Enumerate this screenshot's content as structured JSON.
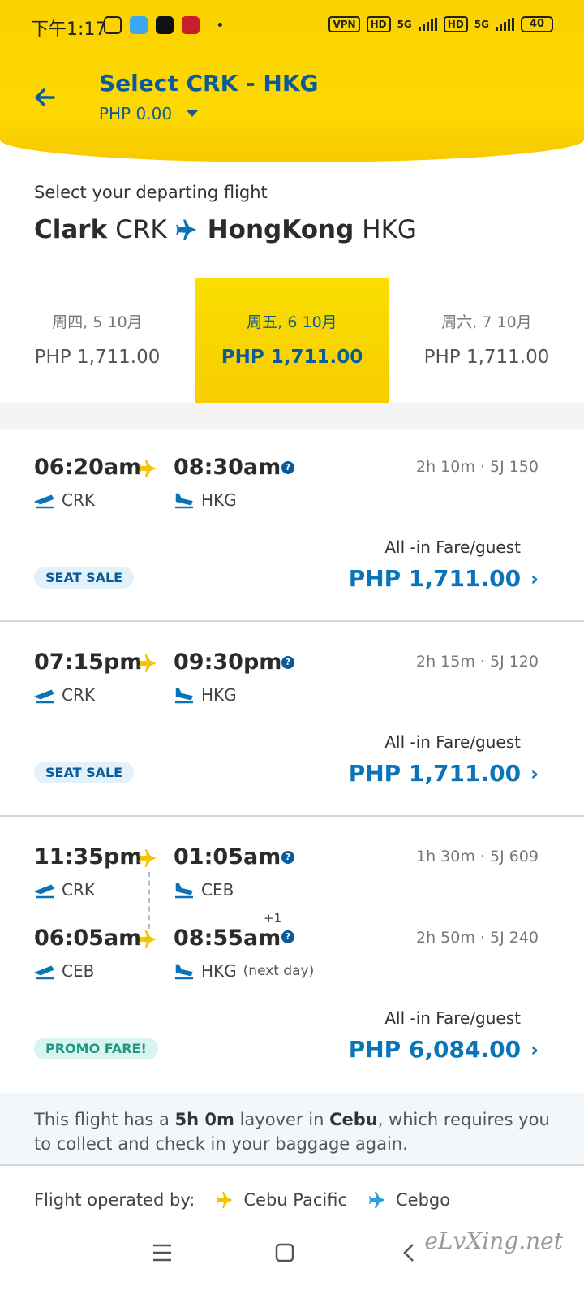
{
  "status_bar": {
    "time": "下午1:17",
    "vpn": "VPN",
    "hd": "HD",
    "net": "5G",
    "battery": "40"
  },
  "header": {
    "title": "Select CRK - HKG",
    "total": "PHP 0.00"
  },
  "route": {
    "label": "Select your departing flight",
    "origin_city": "Clark",
    "origin_code": "CRK",
    "dest_city": "HongKong",
    "dest_code": "HKG"
  },
  "dates": [
    {
      "day": "周四, 5 10月",
      "price": "PHP 1,711.00"
    },
    {
      "day": "周五, 6 10月",
      "price": "PHP 1,711.00",
      "selected": true
    },
    {
      "day": "周六, 7 10月",
      "price": "PHP 1,711.00"
    }
  ],
  "flights": [
    {
      "depart": "06:20am",
      "arrive": "08:30am",
      "from": "CRK",
      "to": "HKG",
      "duration": "2h 10m · 5J 150",
      "fare_label": "All -in Fare/guest",
      "fare": "PHP 1,711.00",
      "badge": "SEAT SALE"
    },
    {
      "depart": "07:15pm",
      "arrive": "09:30pm",
      "from": "CRK",
      "to": "HKG",
      "duration": "2h 15m · 5J 120",
      "fare_label": "All -in Fare/guest",
      "fare": "PHP 1,711.00",
      "badge": "SEAT SALE"
    },
    {
      "leg1": {
        "depart": "11:35pm",
        "arrive": "01:05am",
        "from": "CRK",
        "to": "CEB",
        "duration": "1h 30m · 5J 609"
      },
      "leg2": {
        "depart": "06:05am",
        "arrive": "08:55am",
        "plus": "+1",
        "from": "CEB",
        "to": "HKG",
        "next_day": "(next day)",
        "duration": "2h 50m · 5J 240"
      },
      "fare_label": "All -in Fare/guest",
      "fare": "PHP 6,084.00",
      "badge": "PROMO FARE!"
    }
  ],
  "layover": {
    "pre": "This flight has a ",
    "duration": "5h 0m",
    "mid": " layover in ",
    "city": "Cebu",
    "post": ", which requires you to collect and check in your baggage again."
  },
  "operated": {
    "label": "Flight operated by:",
    "carrier1": "Cebu Pacific",
    "carrier2": "Cebgo"
  },
  "watermark": "eLvXing.net",
  "colors": {
    "brand_yellow": "#fcd800",
    "brand_blue": "#0a5b9c",
    "fare_blue": "#0a74b8"
  }
}
